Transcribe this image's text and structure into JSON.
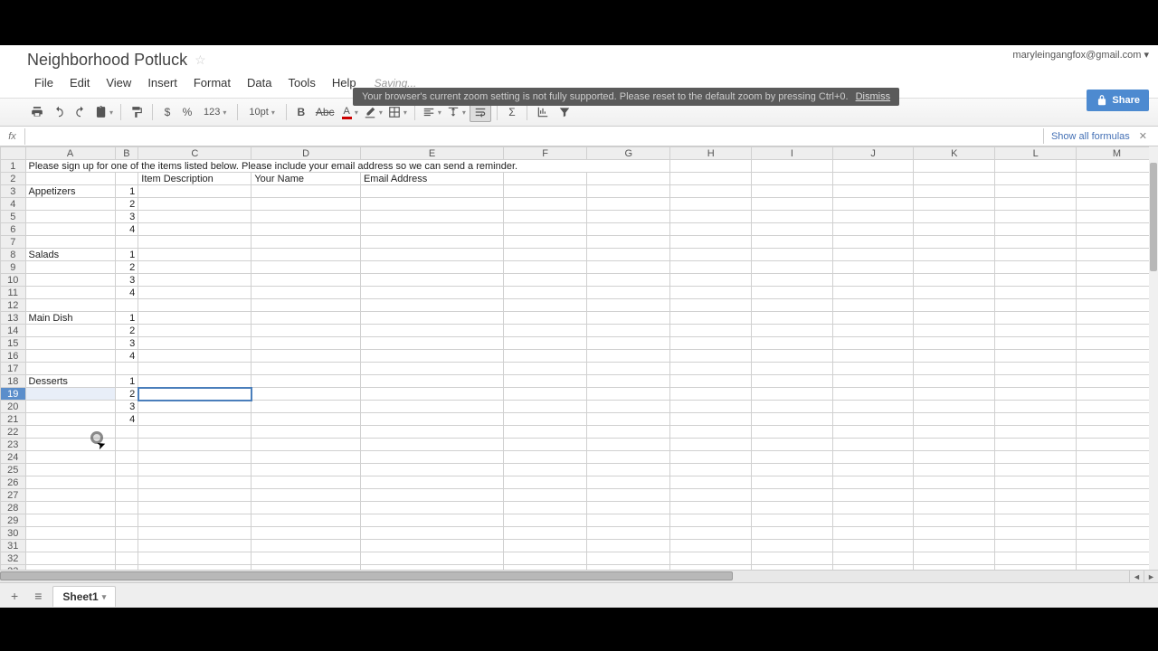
{
  "doc": {
    "title": "Neighborhood Potluck"
  },
  "user": {
    "email": "maryleingangfox@gmail.com ▾"
  },
  "menu": {
    "file": "File",
    "edit": "Edit",
    "view": "View",
    "insert": "Insert",
    "format": "Format",
    "data": "Data",
    "tools": "Tools",
    "help": "Help"
  },
  "status": {
    "saving": "Saving..."
  },
  "warning": {
    "text": "Your browser's current zoom setting is not fully supported. Please reset to the default zoom by pressing Ctrl+0.",
    "dismiss": "Dismiss"
  },
  "share": {
    "label": "Share"
  },
  "toolbar": {
    "currency": "$",
    "percent": "%",
    "numfmt": "123",
    "font_size": "10pt"
  },
  "formula": {
    "show_all": "Show all formulas"
  },
  "columns": [
    "A",
    "B",
    "C",
    "D",
    "E",
    "F",
    "G",
    "H",
    "I",
    "J",
    "K",
    "L",
    "M"
  ],
  "cells": {
    "r1": {
      "a": "Please sign up for one of the items listed below. Please include your email address so we can send a reminder."
    },
    "r2": {
      "c": "Item Description",
      "d": "Your Name",
      "e": "Email Address"
    },
    "r3": {
      "a": "Appetizers",
      "b": "1"
    },
    "r4": {
      "b": "2"
    },
    "r5": {
      "b": "3"
    },
    "r6": {
      "b": "4"
    },
    "r8": {
      "a": "Salads",
      "b": "1"
    },
    "r9": {
      "b": "2"
    },
    "r10": {
      "b": "3"
    },
    "r11": {
      "b": "4"
    },
    "r13": {
      "a": "Main Dish",
      "b": "1"
    },
    "r14": {
      "b": "2"
    },
    "r15": {
      "b": "3"
    },
    "r16": {
      "b": "4"
    },
    "r18": {
      "a": "Desserts",
      "b": "1"
    },
    "r19": {
      "b": "2"
    },
    "r20": {
      "b": "3"
    },
    "r21": {
      "b": "4"
    }
  },
  "selected_row": 19,
  "sheet_tab": "Sheet1"
}
